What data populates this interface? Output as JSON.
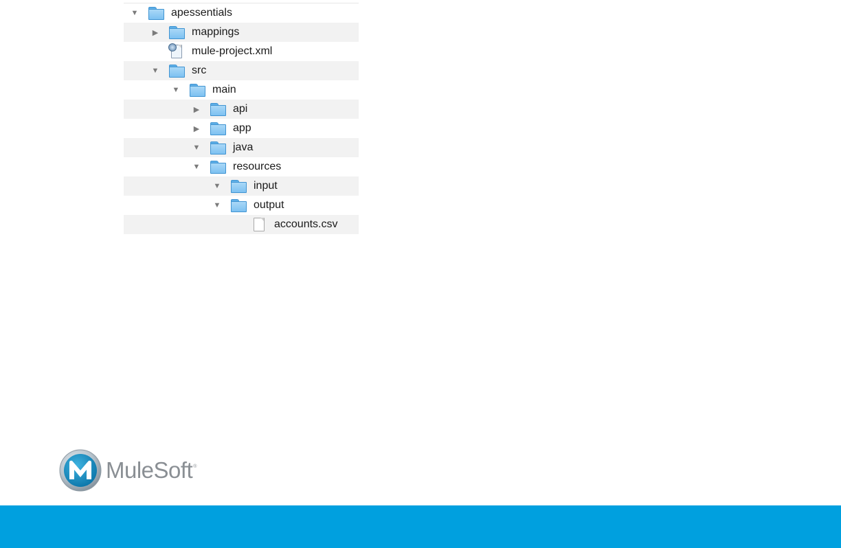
{
  "tree": {
    "rows": [
      {
        "label": "apessentials",
        "type": "folder",
        "depth": 0,
        "expanded": true
      },
      {
        "label": "mappings",
        "type": "folder",
        "depth": 1,
        "expanded": false
      },
      {
        "label": "mule-project.xml",
        "type": "xml-file",
        "depth": 1
      },
      {
        "label": "src",
        "type": "folder",
        "depth": 1,
        "expanded": true
      },
      {
        "label": "main",
        "type": "folder",
        "depth": 2,
        "expanded": true
      },
      {
        "label": "api",
        "type": "folder",
        "depth": 3,
        "expanded": false
      },
      {
        "label": "app",
        "type": "folder",
        "depth": 3,
        "expanded": false
      },
      {
        "label": "java",
        "type": "folder",
        "depth": 3,
        "expanded": true
      },
      {
        "label": "resources",
        "type": "folder",
        "depth": 3,
        "expanded": true
      },
      {
        "label": "input",
        "type": "folder",
        "depth": 4,
        "expanded": true
      },
      {
        "label": "output",
        "type": "folder",
        "depth": 4,
        "expanded": true
      },
      {
        "label": "accounts.csv",
        "type": "file",
        "depth": 5
      }
    ]
  },
  "branding": {
    "logo_text": "MuleSoft",
    "trademark": "®",
    "accent_color": "#00a0df",
    "logo_gray": "#8a8f94"
  },
  "icons": {
    "expanded": "triangle-down-icon",
    "collapsed": "triangle-right-icon",
    "folder": "folder-icon",
    "file": "document-icon",
    "xml": "mule-config-file-icon"
  }
}
